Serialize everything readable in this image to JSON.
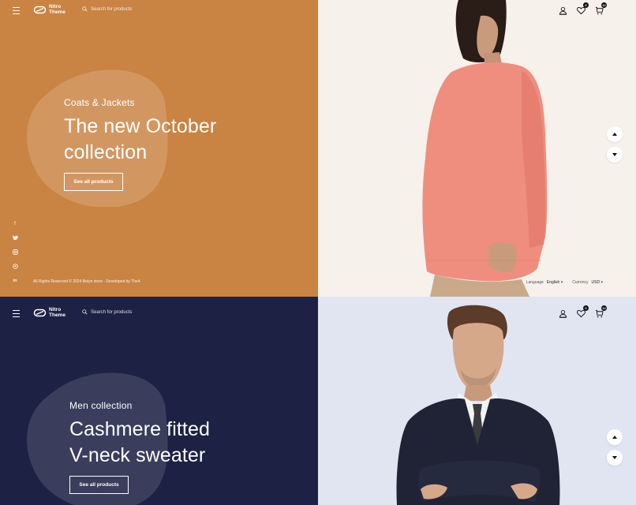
{
  "brand": {
    "name_line1": "Nitro",
    "name_line2": "Theme"
  },
  "search": {
    "placeholder": "Search for products"
  },
  "header_icons": {
    "wishlist_count": "0",
    "cart_count": "12"
  },
  "slides": [
    {
      "subtitle": "Coats & Jackets",
      "title_line1": "The new October",
      "title_line2": "collection",
      "button": "See all products",
      "left_bg": "#c98342",
      "right_bg": "#f6f1ea"
    },
    {
      "subtitle": "Men collection",
      "title_line1": "Cashmere fitted",
      "title_line2": "V-neck sweater",
      "button": "See all products",
      "left_bg": "#1d2244",
      "right_bg": "#e1e5f2"
    }
  ],
  "footer": {
    "copyright": "All Rights Reserved © 2024 Belyn store - Developed by The4"
  },
  "settings": {
    "language_label": "Language",
    "language_value": "English",
    "currency_label": "Currency",
    "currency_value": "USD"
  },
  "socials": [
    "facebook-icon",
    "twitter-icon",
    "instagram-icon",
    "pinterest-icon",
    "linkedin-icon"
  ]
}
